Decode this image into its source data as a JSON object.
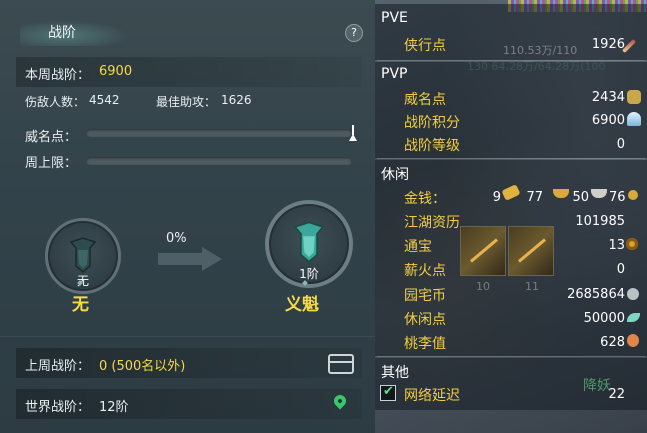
{
  "left": {
    "title": "战阶",
    "help": "?",
    "week_rank_label": "本周战阶：",
    "week_rank_value": "6900",
    "kills_label": "伤敌人数：",
    "kills_value": "4542",
    "assist_label": "最佳助攻：",
    "assist_value": "1626",
    "fame_label": "威名点：",
    "weekly_cap_label": "周上限：",
    "current_medal": {
      "level": "无",
      "name": "无"
    },
    "next_medal": {
      "level": "1阶",
      "name": "义魁"
    },
    "progress_text": "0%",
    "last_week_label": "上周战阶：",
    "last_week_value": "0 (500名以外)",
    "world_rank_label": "世界战阶：",
    "world_rank_value": "12阶"
  },
  "right": {
    "pve": {
      "title": "PVE",
      "rows": [
        {
          "label": "侠行点",
          "value": "1926",
          "icon": "sword-icon"
        }
      ],
      "bg_text_1": "110.53万/110",
      "bg_text_2": "130   64.28万/64.28万(100"
    },
    "pvp": {
      "title": "PVP",
      "rows": [
        {
          "label": "威名点",
          "value": "2434",
          "icon": "fame-token-icon"
        },
        {
          "label": "战阶积分",
          "value": "6900",
          "icon": "crystal-icon"
        },
        {
          "label": "战阶等级",
          "value": "0"
        }
      ]
    },
    "leisure": {
      "title": "休闲",
      "money_label": "金钱：",
      "money": {
        "gold": "9",
        "silver": "77",
        "copper": "50",
        "coin": "76"
      },
      "rows": [
        {
          "label": "江湖资历",
          "value": "101985"
        },
        {
          "label": "通宝",
          "value": "13",
          "icon": "coin-icon"
        },
        {
          "label": "薪火点",
          "value": "0"
        },
        {
          "label": "园宅币",
          "value": "2685864",
          "icon": "home-coin-icon"
        },
        {
          "label": "休闲点",
          "value": "50000",
          "icon": "leaf-icon"
        },
        {
          "label": "桃李值",
          "value": "628",
          "icon": "peach-icon"
        }
      ],
      "skill_numbers": [
        "10",
        "11"
      ]
    },
    "other": {
      "title": "其他",
      "checkbox_label": "网络延迟",
      "checkbox_value": "22",
      "overlay_text": "降妖"
    }
  },
  "colors": {
    "accent_yellow": "#f2cd42",
    "teal": "#6fc7b8"
  }
}
